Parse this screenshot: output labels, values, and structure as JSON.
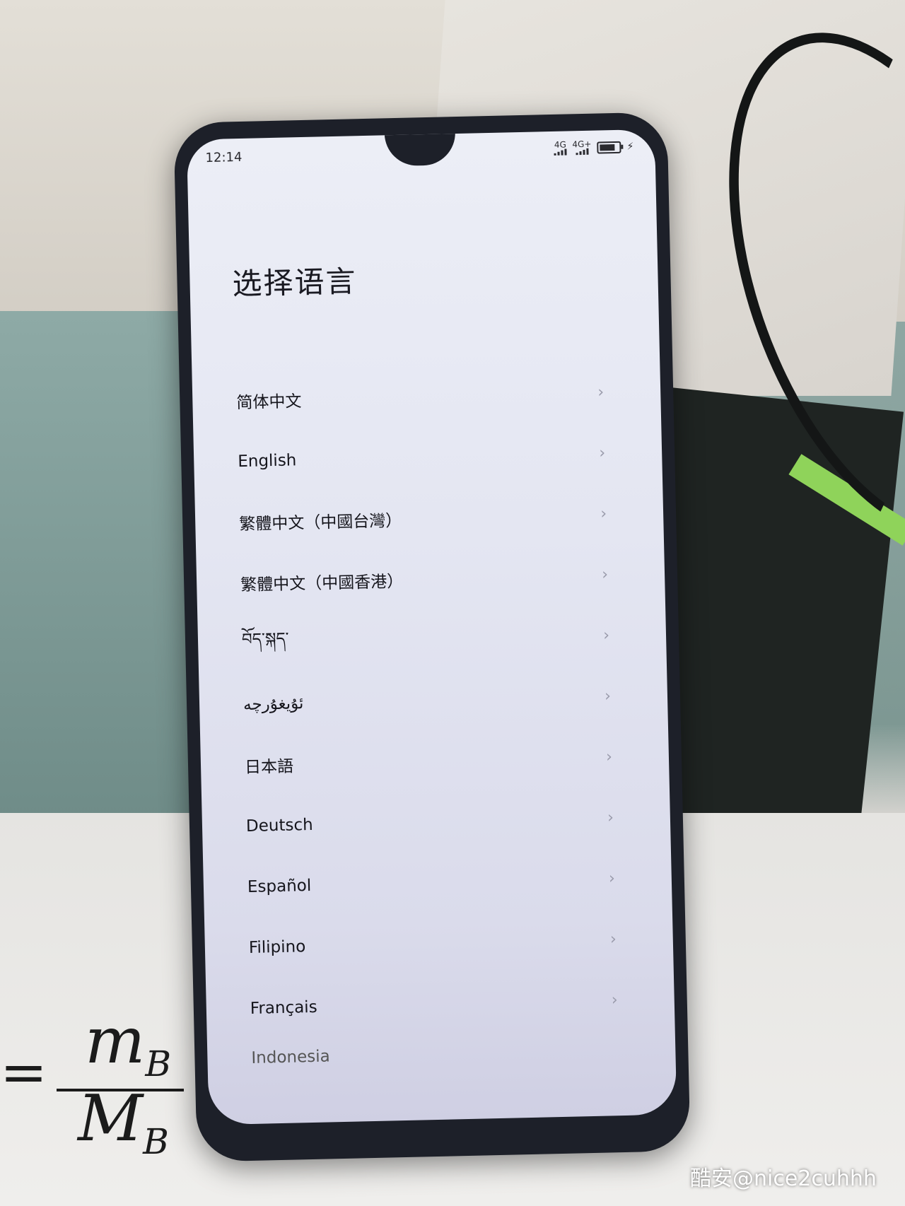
{
  "status_bar": {
    "time": "12:14",
    "signal_1_label": "4G",
    "signal_2_label": "4G+",
    "charging_icon": "bolt-icon"
  },
  "page": {
    "title": "选择语言"
  },
  "languages": [
    {
      "label": "简体中文"
    },
    {
      "label": "English"
    },
    {
      "label": "繁體中文（中國台灣）"
    },
    {
      "label": "繁體中文（中國香港）"
    },
    {
      "label": "བོད་སྐད་"
    },
    {
      "label": "ئۇيغۇرچە"
    },
    {
      "label": "日本語"
    },
    {
      "label": "Deutsch"
    },
    {
      "label": "Español"
    },
    {
      "label": "Filipino"
    },
    {
      "label": "Français"
    },
    {
      "label": "Indonesia"
    }
  ],
  "chevron_glyph": "›",
  "watermark": "酷安@nice2cuhhh",
  "colors": {
    "screen_bg": "#e6e8f3",
    "text": "#15151c",
    "chevron": "#9a9bab",
    "phone_frame": "#1d2029"
  }
}
